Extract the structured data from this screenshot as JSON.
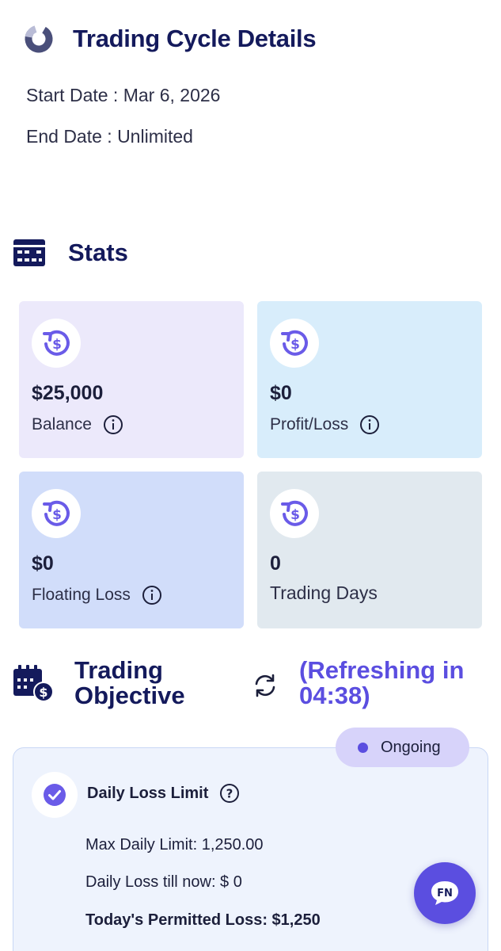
{
  "header": {
    "title": "Trading Cycle Details",
    "logo_icon": "cycle-logo-icon"
  },
  "cycle": {
    "start_date": "Start Date : Mar 6, 2026",
    "end_date": "End Date : Unlimited"
  },
  "stats": {
    "title": "Stats",
    "icon": "stats-card-icon",
    "cards": [
      {
        "value": "$25,000",
        "label": "Balance",
        "has_info": true,
        "bg": "#ece9fb"
      },
      {
        "value": "$0",
        "label": "Profit/Loss",
        "has_info": true,
        "bg": "#d8edfb"
      },
      {
        "value": "$0",
        "label": "Floating Loss",
        "has_info": true,
        "bg": "#d1ddfa"
      },
      {
        "value": "0",
        "label": "Trading Days",
        "has_info": false,
        "bg": "#e1e9ef"
      }
    ]
  },
  "objective": {
    "title": "Trading Objective",
    "refresh_text": "(Refreshing in 04:38)",
    "status": "Ongoing",
    "item_title": "Daily Loss Limit",
    "max_daily_limit": "Max Daily Limit: 1,250.00",
    "loss_till_now": "Daily Loss till now: $ 0",
    "permitted_loss": "Today's Permitted Loss: $1,250"
  },
  "colors": {
    "accent": "#5b4ee0",
    "navy": "#141a5c"
  }
}
